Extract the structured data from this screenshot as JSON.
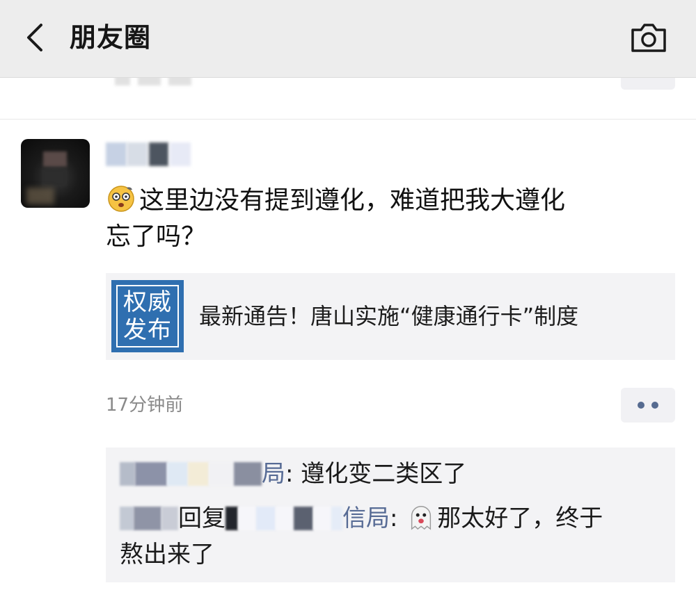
{
  "nav": {
    "title": "朋友圈",
    "back_icon": "chevron-left-icon",
    "camera_icon": "camera-icon"
  },
  "post": {
    "text_line1": "这里边没有提到遵化，难道把我大遵化",
    "text_line2": "忘了吗？",
    "emoji": "dizzy-face-emoji",
    "link": {
      "thumb_line1": "权威",
      "thumb_line2": "发布",
      "title": "最新通告！唐山实施“健康通行卡”制度"
    },
    "time": "17分钟前"
  },
  "comments": [
    {
      "name_visible_suffix": "局",
      "separator": ": ",
      "text": "遵化变二类区了"
    },
    {
      "reply_word": "回复",
      "target_visible_suffix": "信局",
      "separator": ": ",
      "emoji": "ghost-emoji",
      "text_line1": "那太好了，终于",
      "text_line2": "熬出来了"
    }
  ],
  "colors": {
    "topbar": "#ededed",
    "name_blue": "#576b95",
    "thumb_blue": "#2f6fb0",
    "card_bg": "#f3f3f5"
  }
}
